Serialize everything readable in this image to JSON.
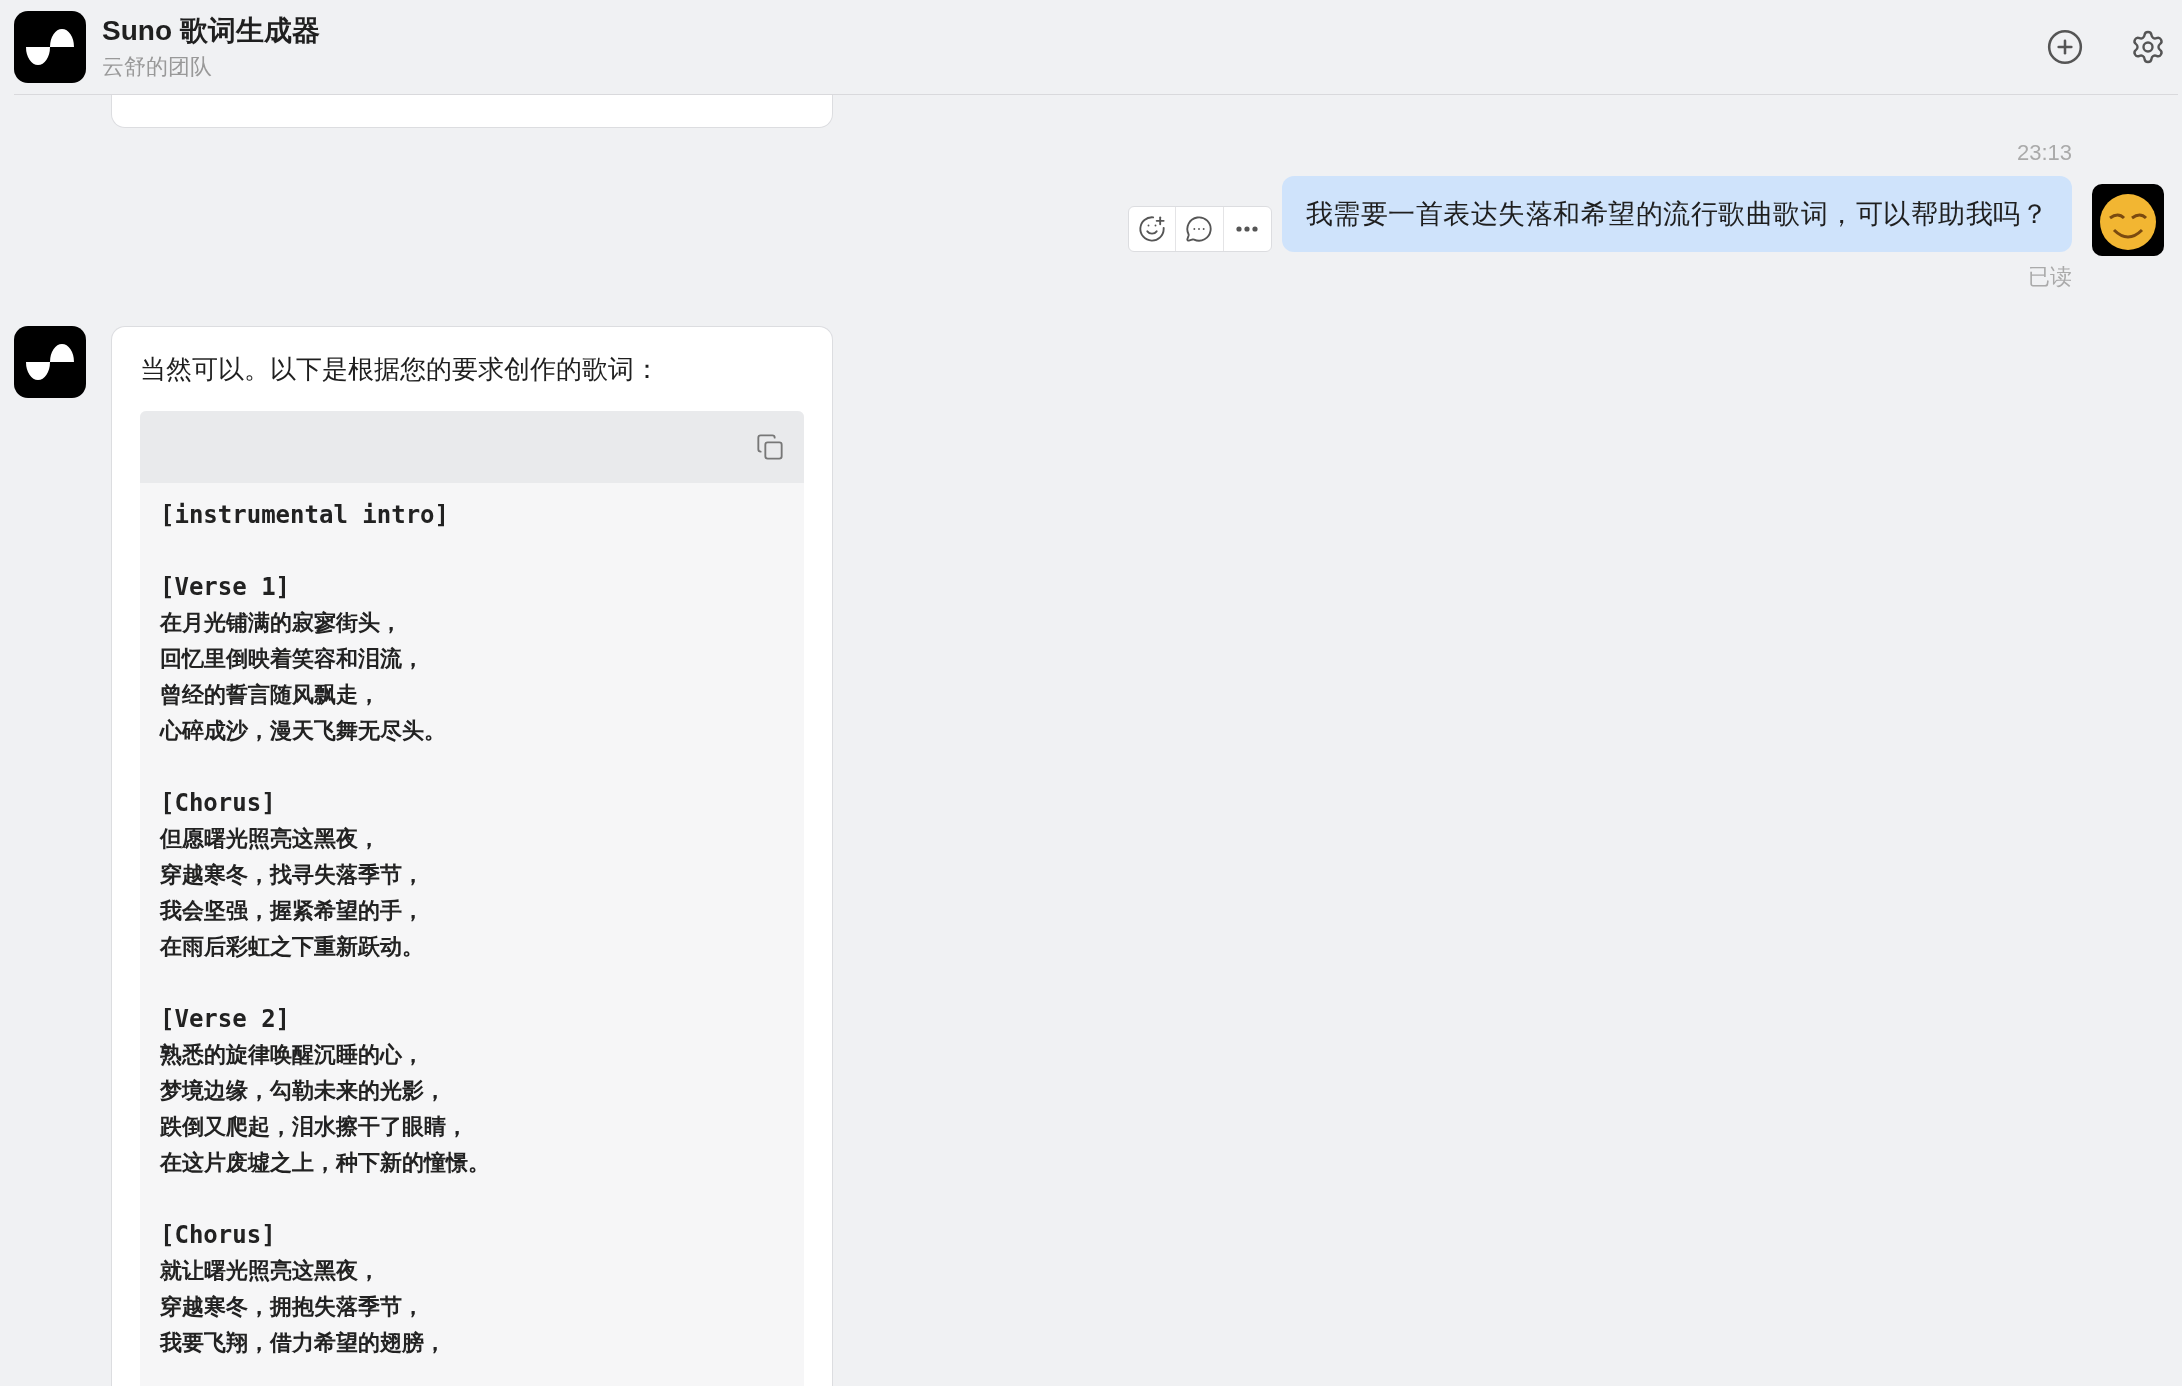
{
  "header": {
    "title": "Suno 歌词生成器",
    "subtitle": "云舒的团队"
  },
  "user_message": {
    "time": "23:13",
    "text": "我需要一首表达失落和希望的流行歌曲歌词，可以帮助我吗？",
    "status": "已读"
  },
  "bot_message": {
    "intro": "当然可以。以下是根据您的要求创作的歌词：",
    "lyrics": [
      {
        "heading": "[instrumental intro]"
      },
      {
        "heading": "[Verse 1]",
        "lines": [
          "在月光铺满的寂寥街头，",
          "回忆里倒映着笑容和泪流，",
          "曾经的誓言随风飘走，",
          "心碎成沙，漫天飞舞无尽头。"
        ]
      },
      {
        "heading": "[Chorus]",
        "lines": [
          "但愿曙光照亮这黑夜，",
          "穿越寒冬，找寻失落季节，",
          "我会坚强，握紧希望的手，",
          "在雨后彩虹之下重新跃动。"
        ]
      },
      {
        "heading": "[Verse 2]",
        "lines": [
          "熟悉的旋律唤醒沉睡的心，",
          "梦境边缘，勾勒未来的光影，",
          "跌倒又爬起，泪水擦干了眼睛，",
          "在这片废墟之上，种下新的憧憬。"
        ]
      },
      {
        "heading": "[Chorus]",
        "lines": [
          "就让曙光照亮这黑夜，",
          "穿越寒冬，拥抱失落季节，",
          "我要飞翔，借力希望的翅膀，"
        ]
      }
    ]
  }
}
